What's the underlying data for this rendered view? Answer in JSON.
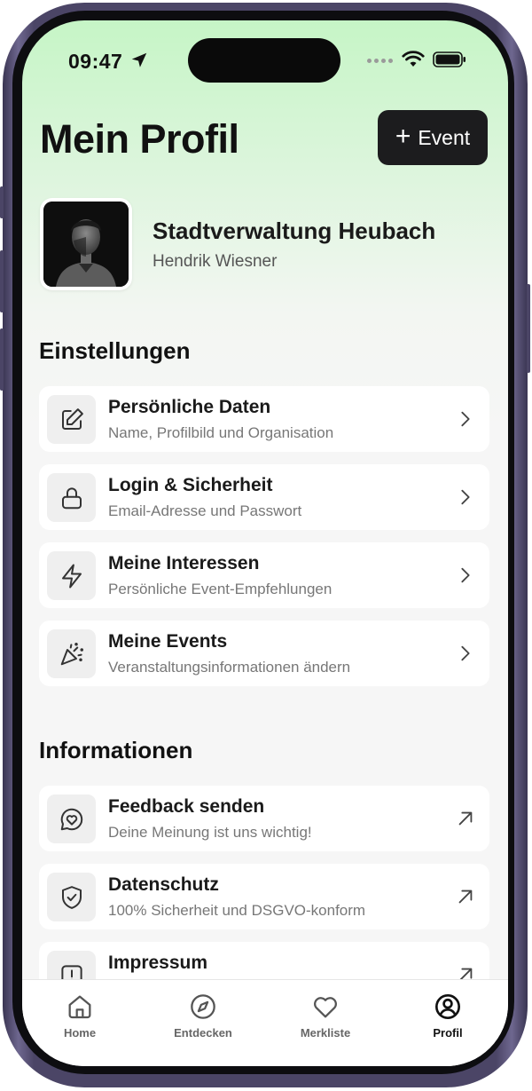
{
  "status_bar": {
    "time": "09:47"
  },
  "header": {
    "title": "Mein Profil",
    "event_button_label": "Event",
    "event_button_plus": "+"
  },
  "profile": {
    "name": "Stadtverwaltung Heubach",
    "subtitle": "Hendrik Wiesner"
  },
  "settings": {
    "title": "Einstellungen",
    "items": [
      {
        "title": "Persönliche Daten",
        "subtitle": "Name, Profilbild und Organisation",
        "icon": "edit-icon"
      },
      {
        "title": "Login & Sicherheit",
        "subtitle": "Email-Adresse und Passwort",
        "icon": "lock-icon"
      },
      {
        "title": "Meine Interessen",
        "subtitle": "Persönliche Event-Empfehlungen",
        "icon": "lightning-icon"
      },
      {
        "title": "Meine Events",
        "subtitle": "Veranstaltungsinformationen ändern",
        "icon": "party-popper-icon"
      }
    ]
  },
  "information": {
    "title": "Informationen",
    "items": [
      {
        "title": "Feedback senden",
        "subtitle": "Deine Meinung ist uns wichtig!",
        "icon": "feedback-heart-icon"
      },
      {
        "title": "Datenschutz",
        "subtitle": "100% Sicherheit und DSGVO-konform",
        "icon": "shield-check-icon"
      },
      {
        "title": "Impressum",
        "subtitle": "",
        "icon": "alert-square-icon"
      }
    ]
  },
  "tab_bar": {
    "tabs": [
      {
        "label": "Home",
        "icon": "home-icon"
      },
      {
        "label": "Entdecken",
        "icon": "compass-icon"
      },
      {
        "label": "Merkliste",
        "icon": "heart-icon"
      },
      {
        "label": "Profil",
        "icon": "profile-icon",
        "active": true
      }
    ]
  },
  "colors": {
    "accent_dark": "#1c1c1e",
    "header_gradient_top": "#c6f5c6",
    "background": "#f6f6f6"
  }
}
